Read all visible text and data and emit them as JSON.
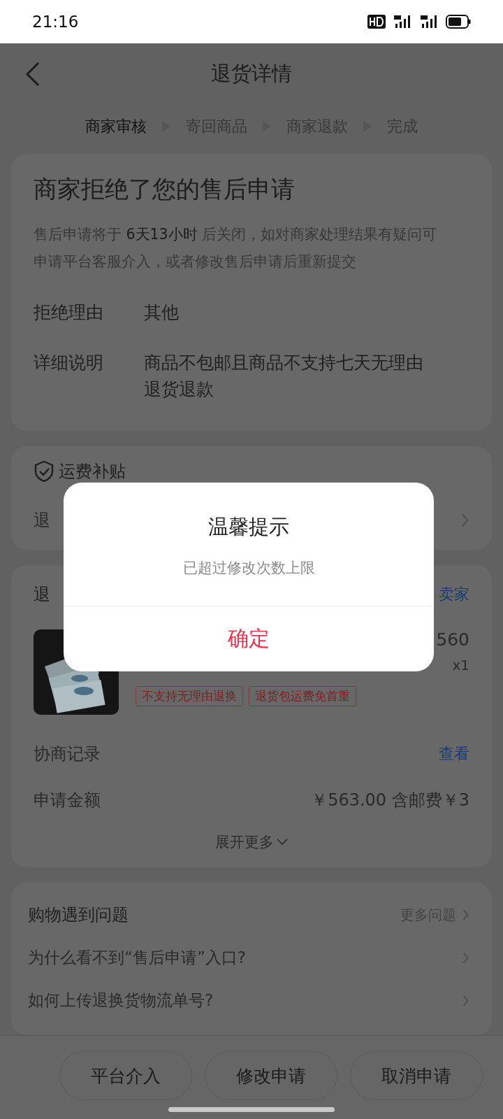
{
  "status_bar": {
    "time": "21:16"
  },
  "nav": {
    "title": "退货详情"
  },
  "steps": [
    {
      "label": "商家审核",
      "selected": true
    },
    {
      "label": "寄回商品",
      "selected": false
    },
    {
      "label": "商家退款",
      "selected": false
    },
    {
      "label": "完成",
      "selected": false
    }
  ],
  "status_card": {
    "title": "商家拒绝了您的售后申请",
    "notice": "售后申请将于 **6天13小时** 后关闭，如对商家处理结果有疑问可申请平台客服介入，或者修改售后申请后重新提交",
    "fields": [
      {
        "label": "拒绝理由",
        "value": "其他"
      },
      {
        "label": "详细说明",
        "value": "商品不包邮且商品不支持七天无理由退货退款"
      }
    ]
  },
  "subsidy_card": {
    "title": "运费补贴",
    "row_label": "退"
  },
  "product_card": {
    "header": "退",
    "contact": "卖家",
    "price": "560",
    "quantity": "x1",
    "tags": [
      "不支持无理由退换",
      "退货包运费免首重"
    ],
    "rows": [
      {
        "label": "协商记录",
        "value": "查看",
        "kind": "link"
      },
      {
        "label": "申请金额",
        "value": "￥563.00 含邮费￥3",
        "kind": "text"
      }
    ],
    "expand": "展开更多"
  },
  "help": {
    "title": "购物遇到问题",
    "more": "更多问题",
    "questions": [
      "为什么看不到“售后申请”入口?",
      "如何上传退换货物流单号?"
    ]
  },
  "actions": [
    "平台介入",
    "修改申请",
    "取消申请"
  ],
  "dialog": {
    "title": "温馨提示",
    "message": "已超过修改次数上限",
    "confirm": "确定"
  }
}
